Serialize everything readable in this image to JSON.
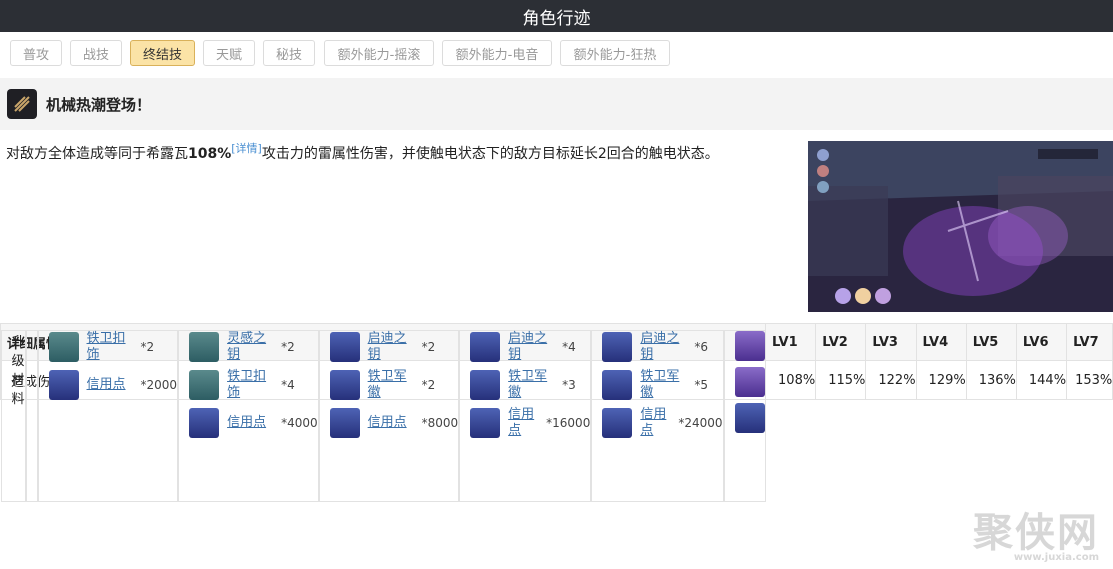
{
  "header": {
    "title": "角色行迹"
  },
  "tabs": [
    {
      "label": "普攻"
    },
    {
      "label": "战技"
    },
    {
      "label": "终结技"
    },
    {
      "label": "天赋"
    },
    {
      "label": "秘技"
    },
    {
      "label": "额外能力-摇滚"
    },
    {
      "label": "额外能力-电音"
    },
    {
      "label": "额外能力-狂热"
    }
  ],
  "skill": {
    "name": "机械热潮登场！",
    "desc_pre": "对敌方全体造成等同于希露瓦",
    "desc_value": "108%",
    "desc_link": "[详情]",
    "desc_post": "攻击力的雷属性伤害，并使触电状态下的敌方目标延长2回合的触电状态。"
  },
  "table": {
    "headers": [
      "详细属性",
      "LV1",
      "LV2",
      "LV3",
      "LV4",
      "LV5",
      "LV6",
      "LV7"
    ],
    "damage_label": "造成伤害",
    "damage": [
      "108%",
      "115%",
      "122%",
      "129%",
      "136%",
      "144%",
      "153%"
    ],
    "materials_label": "升级材料",
    "materials": {
      "lv2": [
        {
          "name": "铁卫扣饰",
          "qty": "*2"
        },
        {
          "name": "信用点",
          "qty": "*2000"
        }
      ],
      "lv3": [
        {
          "name": "灵感之钥",
          "qty": "*2"
        },
        {
          "name": "铁卫扣饰",
          "qty": "*4"
        },
        {
          "name": "信用点",
          "qty": "*4000"
        }
      ],
      "lv4": [
        {
          "name": "启迪之钥",
          "qty": "*2"
        },
        {
          "name": "铁卫军徽",
          "qty": "*2"
        },
        {
          "name": "信用点",
          "qty": "*8000"
        }
      ],
      "lv5": [
        {
          "name": "启迪之钥",
          "qty": "*4"
        },
        {
          "name": "铁卫军徽",
          "qty": "*3"
        },
        {
          "name": "信用点",
          "qty": "*16000"
        }
      ],
      "lv6": [
        {
          "name": "启迪之钥",
          "qty": "*6"
        },
        {
          "name": "铁卫军徽",
          "qty": "*5"
        },
        {
          "name": "信用点",
          "qty": "*24000"
        }
      ]
    }
  },
  "watermark": {
    "text": "聚侠网",
    "url": "www.juxia.com"
  }
}
